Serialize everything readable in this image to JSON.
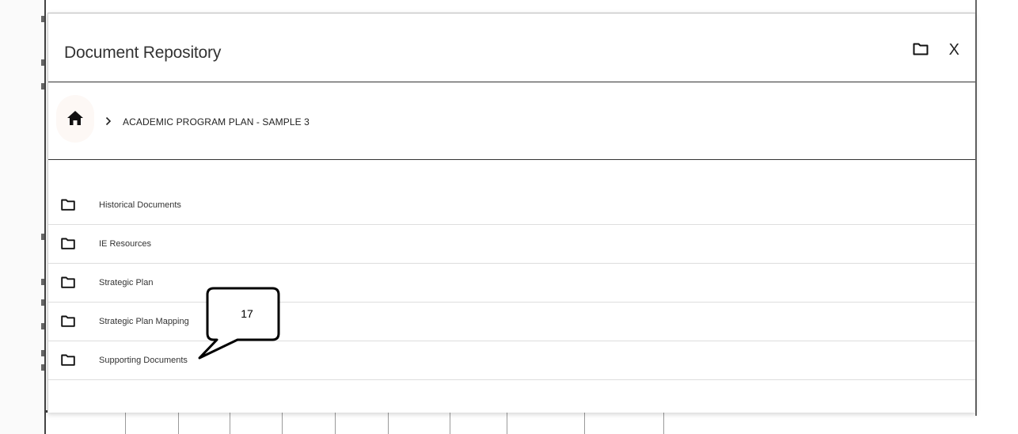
{
  "modal": {
    "title": "Document Repository",
    "close_label": "X"
  },
  "breadcrumb": {
    "separator": ">",
    "current": "ACADEMIC PROGRAM PLAN - SAMPLE 3"
  },
  "folders": [
    {
      "label": "Historical Documents",
      "icon": "folder-icon"
    },
    {
      "label": "IE Resources",
      "icon": "folder-icon"
    },
    {
      "label": "Strategic Plan",
      "icon": "folder-icon"
    },
    {
      "label": "Strategic Plan Mapping",
      "icon": "folder-icon"
    },
    {
      "label": "Supporting Documents",
      "icon": "folder-icon"
    }
  ],
  "callout": {
    "label": "17"
  },
  "icons": {
    "home": "home-icon",
    "new_folder": "folder-icon",
    "close": "close-icon",
    "chevron": "chevron-right-icon"
  },
  "colors": {
    "text": "#333333",
    "divider": "#333333",
    "row_divider": "#dedede",
    "home_bg": "#fdf8f5"
  }
}
